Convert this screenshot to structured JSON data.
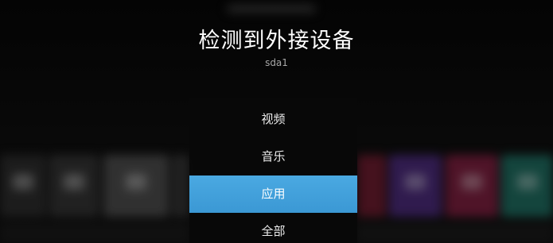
{
  "dialog": {
    "title": "检测到外接设备",
    "device": "sda1"
  },
  "menu": {
    "items": [
      {
        "label": "视频"
      },
      {
        "label": "音乐"
      },
      {
        "label": "应用"
      },
      {
        "label": "全部"
      }
    ],
    "selected_label": "应用"
  },
  "colors": {
    "selected_bg": "#43a2dc",
    "menu_bg": "#080808",
    "tile_purple": "#4a2a78",
    "tile_magenta": "#7a1f3e",
    "tile_teal": "#1f6a5e",
    "tile_gray": "#3a3a3a"
  }
}
